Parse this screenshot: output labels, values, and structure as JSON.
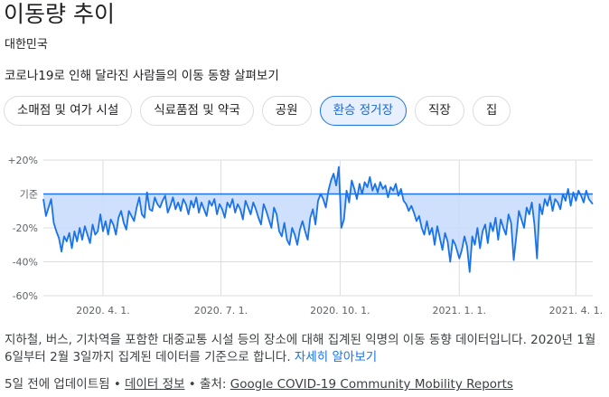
{
  "header": {
    "title": "이동량 추이",
    "region": "대한민국",
    "subtitle": "코로나19로 인해 달라진 사람들의 이동 동향 살펴보기"
  },
  "chips": [
    {
      "label": "소매점 및 여가 시설",
      "selected": false
    },
    {
      "label": "식료품점 및 약국",
      "selected": false
    },
    {
      "label": "공원",
      "selected": false
    },
    {
      "label": "환승 정거장",
      "selected": true
    },
    {
      "label": "직장",
      "selected": false
    },
    {
      "label": "집",
      "selected": false
    }
  ],
  "colors": {
    "line": "#1a73e8",
    "fill": "#c6dafc",
    "grid": "#dadce0",
    "chip_selected_bg": "#e8f0fe",
    "chip_selected_border": "#1a73e8"
  },
  "chart_data": {
    "type": "area",
    "title": "",
    "xlabel": "",
    "ylabel": "",
    "ylim": [
      -60,
      20
    ],
    "y_ticks": [
      {
        "value": 20,
        "label": "+20%"
      },
      {
        "value": 0,
        "label": "기준"
      },
      {
        "value": -20,
        "label": "-20%"
      },
      {
        "value": -40,
        "label": "-40%"
      },
      {
        "value": -60,
        "label": "-60%"
      }
    ],
    "x_ticks": [
      "2020. 4. 1.",
      "2020. 7. 1.",
      "2020. 10. 1.",
      "2021. 1. 1.",
      "2021. 4. 1."
    ],
    "x_range": [
      "2020-02-15",
      "2021-04-14"
    ],
    "grid": true,
    "series": [
      {
        "values": [
          {
            "x": "2020-02-15",
            "y": -3
          },
          {
            "x": "2020-02-17",
            "y": -13
          },
          {
            "x": "2020-02-19",
            "y": -8
          },
          {
            "x": "2020-02-21",
            "y": -3
          },
          {
            "x": "2020-02-23",
            "y": -17
          },
          {
            "x": "2020-02-25",
            "y": -22
          },
          {
            "x": "2020-02-27",
            "y": -26
          },
          {
            "x": "2020-02-29",
            "y": -34
          },
          {
            "x": "2020-03-02",
            "y": -25
          },
          {
            "x": "2020-03-04",
            "y": -28
          },
          {
            "x": "2020-03-06",
            "y": -23
          },
          {
            "x": "2020-03-08",
            "y": -32
          },
          {
            "x": "2020-03-10",
            "y": -22
          },
          {
            "x": "2020-03-12",
            "y": -28
          },
          {
            "x": "2020-03-14",
            "y": -20
          },
          {
            "x": "2020-03-16",
            "y": -27
          },
          {
            "x": "2020-03-18",
            "y": -19
          },
          {
            "x": "2020-03-20",
            "y": -24
          },
          {
            "x": "2020-03-22",
            "y": -29
          },
          {
            "x": "2020-03-24",
            "y": -18
          },
          {
            "x": "2020-03-26",
            "y": -24
          },
          {
            "x": "2020-03-28",
            "y": -22
          },
          {
            "x": "2020-03-30",
            "y": -12
          },
          {
            "x": "2020-04-01",
            "y": -22
          },
          {
            "x": "2020-04-03",
            "y": -16
          },
          {
            "x": "2020-04-05",
            "y": -24
          },
          {
            "x": "2020-04-07",
            "y": -15
          },
          {
            "x": "2020-04-09",
            "y": -18
          },
          {
            "x": "2020-04-11",
            "y": -24
          },
          {
            "x": "2020-04-13",
            "y": -14
          },
          {
            "x": "2020-04-15",
            "y": -10
          },
          {
            "x": "2020-04-17",
            "y": -17
          },
          {
            "x": "2020-04-19",
            "y": -21
          },
          {
            "x": "2020-04-21",
            "y": -10
          },
          {
            "x": "2020-04-23",
            "y": -13
          },
          {
            "x": "2020-04-25",
            "y": -16
          },
          {
            "x": "2020-04-27",
            "y": -8
          },
          {
            "x": "2020-04-29",
            "y": -2
          },
          {
            "x": "2020-05-01",
            "y": -12
          },
          {
            "x": "2020-05-03",
            "y": -14
          },
          {
            "x": "2020-05-05",
            "y": 1
          },
          {
            "x": "2020-05-07",
            "y": -9
          },
          {
            "x": "2020-05-09",
            "y": -10
          },
          {
            "x": "2020-05-11",
            "y": -2
          },
          {
            "x": "2020-05-13",
            "y": -6
          },
          {
            "x": "2020-05-15",
            "y": -8
          },
          {
            "x": "2020-05-17",
            "y": -4
          },
          {
            "x": "2020-05-19",
            "y": -1
          },
          {
            "x": "2020-05-21",
            "y": -11
          },
          {
            "x": "2020-05-23",
            "y": -7
          },
          {
            "x": "2020-05-25",
            "y": -2
          },
          {
            "x": "2020-05-27",
            "y": -9
          },
          {
            "x": "2020-05-29",
            "y": -5
          },
          {
            "x": "2020-05-31",
            "y": -10
          },
          {
            "x": "2020-06-02",
            "y": -3
          },
          {
            "x": "2020-06-04",
            "y": -6
          },
          {
            "x": "2020-06-06",
            "y": -12
          },
          {
            "x": "2020-06-08",
            "y": -4
          },
          {
            "x": "2020-06-10",
            "y": -8
          },
          {
            "x": "2020-06-12",
            "y": -2
          },
          {
            "x": "2020-06-14",
            "y": -11
          },
          {
            "x": "2020-06-16",
            "y": -5
          },
          {
            "x": "2020-06-18",
            "y": -9
          },
          {
            "x": "2020-06-20",
            "y": -13
          },
          {
            "x": "2020-06-22",
            "y": -4
          },
          {
            "x": "2020-06-24",
            "y": -7
          },
          {
            "x": "2020-06-26",
            "y": -3
          },
          {
            "x": "2020-06-28",
            "y": -12
          },
          {
            "x": "2020-06-30",
            "y": -6
          },
          {
            "x": "2020-07-02",
            "y": -9
          },
          {
            "x": "2020-07-04",
            "y": -14
          },
          {
            "x": "2020-07-06",
            "y": -5
          },
          {
            "x": "2020-07-08",
            "y": -8
          },
          {
            "x": "2020-07-10",
            "y": -3
          },
          {
            "x": "2020-07-12",
            "y": -11
          },
          {
            "x": "2020-07-14",
            "y": -6
          },
          {
            "x": "2020-07-16",
            "y": -9
          },
          {
            "x": "2020-07-18",
            "y": -15
          },
          {
            "x": "2020-07-20",
            "y": -4
          },
          {
            "x": "2020-07-22",
            "y": -8
          },
          {
            "x": "2020-07-24",
            "y": -12
          },
          {
            "x": "2020-07-26",
            "y": -5
          },
          {
            "x": "2020-07-28",
            "y": -9
          },
          {
            "x": "2020-07-30",
            "y": -14
          },
          {
            "x": "2020-08-01",
            "y": -18
          },
          {
            "x": "2020-08-03",
            "y": -6
          },
          {
            "x": "2020-08-05",
            "y": -10
          },
          {
            "x": "2020-08-07",
            "y": -15
          },
          {
            "x": "2020-08-09",
            "y": -20
          },
          {
            "x": "2020-08-11",
            "y": -8
          },
          {
            "x": "2020-08-13",
            "y": -12
          },
          {
            "x": "2020-08-15",
            "y": -22
          },
          {
            "x": "2020-08-17",
            "y": -25
          },
          {
            "x": "2020-08-19",
            "y": -17
          },
          {
            "x": "2020-08-21",
            "y": -27
          },
          {
            "x": "2020-08-23",
            "y": -30
          },
          {
            "x": "2020-08-25",
            "y": -20
          },
          {
            "x": "2020-08-27",
            "y": -24
          },
          {
            "x": "2020-08-29",
            "y": -30
          },
          {
            "x": "2020-08-31",
            "y": -21
          },
          {
            "x": "2020-09-02",
            "y": -16
          },
          {
            "x": "2020-09-04",
            "y": -22
          },
          {
            "x": "2020-09-06",
            "y": -27
          },
          {
            "x": "2020-09-08",
            "y": -14
          },
          {
            "x": "2020-09-10",
            "y": -9
          },
          {
            "x": "2020-09-12",
            "y": -18
          },
          {
            "x": "2020-09-14",
            "y": -4
          },
          {
            "x": "2020-09-16",
            "y": 0
          },
          {
            "x": "2020-09-18",
            "y": -3
          },
          {
            "x": "2020-09-20",
            "y": -8
          },
          {
            "x": "2020-09-22",
            "y": 2
          },
          {
            "x": "2020-09-24",
            "y": 8
          },
          {
            "x": "2020-09-26",
            "y": 12
          },
          {
            "x": "2020-09-28",
            "y": 5
          },
          {
            "x": "2020-09-30",
            "y": 16
          },
          {
            "x": "2020-10-02",
            "y": -20
          },
          {
            "x": "2020-10-04",
            "y": -15
          },
          {
            "x": "2020-10-06",
            "y": 2
          },
          {
            "x": "2020-10-08",
            "y": -5
          },
          {
            "x": "2020-10-10",
            "y": 8
          },
          {
            "x": "2020-10-12",
            "y": 3
          },
          {
            "x": "2020-10-14",
            "y": -3
          },
          {
            "x": "2020-10-16",
            "y": 6
          },
          {
            "x": "2020-10-18",
            "y": 0
          },
          {
            "x": "2020-10-20",
            "y": 7
          },
          {
            "x": "2020-10-22",
            "y": 4
          },
          {
            "x": "2020-10-24",
            "y": 10
          },
          {
            "x": "2020-10-26",
            "y": 2
          },
          {
            "x": "2020-10-28",
            "y": 6
          },
          {
            "x": "2020-10-30",
            "y": 1
          },
          {
            "x": "2020-11-01",
            "y": 7
          },
          {
            "x": "2020-11-03",
            "y": 3
          },
          {
            "x": "2020-11-05",
            "y": 5
          },
          {
            "x": "2020-11-07",
            "y": -2
          },
          {
            "x": "2020-11-09",
            "y": 4
          },
          {
            "x": "2020-11-11",
            "y": 2
          },
          {
            "x": "2020-11-13",
            "y": 6
          },
          {
            "x": "2020-11-15",
            "y": -1
          },
          {
            "x": "2020-11-17",
            "y": 3
          },
          {
            "x": "2020-11-19",
            "y": -4
          },
          {
            "x": "2020-11-21",
            "y": -6
          },
          {
            "x": "2020-11-23",
            "y": -10
          },
          {
            "x": "2020-11-25",
            "y": -7
          },
          {
            "x": "2020-11-27",
            "y": -11
          },
          {
            "x": "2020-11-29",
            "y": -16
          },
          {
            "x": "2020-12-01",
            "y": -13
          },
          {
            "x": "2020-12-03",
            "y": -20
          },
          {
            "x": "2020-12-05",
            "y": -24
          },
          {
            "x": "2020-12-07",
            "y": -16
          },
          {
            "x": "2020-12-09",
            "y": -24
          },
          {
            "x": "2020-12-11",
            "y": -20
          },
          {
            "x": "2020-12-13",
            "y": -30
          },
          {
            "x": "2020-12-15",
            "y": -19
          },
          {
            "x": "2020-12-17",
            "y": -26
          },
          {
            "x": "2020-12-19",
            "y": -33
          },
          {
            "x": "2020-12-21",
            "y": -23
          },
          {
            "x": "2020-12-23",
            "y": -28
          },
          {
            "x": "2020-12-25",
            "y": -40
          },
          {
            "x": "2020-12-27",
            "y": -27
          },
          {
            "x": "2020-12-29",
            "y": -30
          },
          {
            "x": "2021-01-01",
            "y": -38
          },
          {
            "x": "2021-01-03",
            "y": -33
          },
          {
            "x": "2021-01-05",
            "y": -25
          },
          {
            "x": "2021-01-07",
            "y": -31
          },
          {
            "x": "2021-01-09",
            "y": -46
          },
          {
            "x": "2021-01-11",
            "y": -25
          },
          {
            "x": "2021-01-13",
            "y": -30
          },
          {
            "x": "2021-01-15",
            "y": -20
          },
          {
            "x": "2021-01-17",
            "y": -32
          },
          {
            "x": "2021-01-19",
            "y": -22
          },
          {
            "x": "2021-01-21",
            "y": -18
          },
          {
            "x": "2021-01-23",
            "y": -29
          },
          {
            "x": "2021-01-25",
            "y": -17
          },
          {
            "x": "2021-01-27",
            "y": -22
          },
          {
            "x": "2021-01-29",
            "y": -14
          },
          {
            "x": "2021-01-31",
            "y": -27
          },
          {
            "x": "2021-02-02",
            "y": -15
          },
          {
            "x": "2021-02-04",
            "y": -20
          },
          {
            "x": "2021-02-06",
            "y": -24
          },
          {
            "x": "2021-02-08",
            "y": -12
          },
          {
            "x": "2021-02-10",
            "y": -17
          },
          {
            "x": "2021-02-12",
            "y": -39
          },
          {
            "x": "2021-02-14",
            "y": -25
          },
          {
            "x": "2021-02-16",
            "y": -10
          },
          {
            "x": "2021-02-18",
            "y": -15
          },
          {
            "x": "2021-02-20",
            "y": -20
          },
          {
            "x": "2021-02-22",
            "y": -8
          },
          {
            "x": "2021-02-24",
            "y": -12
          },
          {
            "x": "2021-02-26",
            "y": -5
          },
          {
            "x": "2021-02-28",
            "y": -18
          },
          {
            "x": "2021-03-02",
            "y": -38
          },
          {
            "x": "2021-03-04",
            "y": -6
          },
          {
            "x": "2021-03-06",
            "y": -12
          },
          {
            "x": "2021-03-08",
            "y": -3
          },
          {
            "x": "2021-03-10",
            "y": -7
          },
          {
            "x": "2021-03-12",
            "y": -1
          },
          {
            "x": "2021-03-14",
            "y": -10
          },
          {
            "x": "2021-03-16",
            "y": -3
          },
          {
            "x": "2021-03-18",
            "y": -5
          },
          {
            "x": "2021-03-20",
            "y": -9
          },
          {
            "x": "2021-03-22",
            "y": 0
          },
          {
            "x": "2021-03-24",
            "y": -4
          },
          {
            "x": "2021-03-26",
            "y": 3
          },
          {
            "x": "2021-03-28",
            "y": -7
          },
          {
            "x": "2021-03-30",
            "y": 1
          },
          {
            "x": "2021-04-01",
            "y": -4
          },
          {
            "x": "2021-04-03",
            "y": 2
          },
          {
            "x": "2021-04-05",
            "y": -1
          },
          {
            "x": "2021-04-07",
            "y": -5
          },
          {
            "x": "2021-04-09",
            "y": 2
          },
          {
            "x": "2021-04-11",
            "y": -3
          },
          {
            "x": "2021-04-14",
            "y": -6
          }
        ]
      }
    ]
  },
  "description": {
    "text": "지하철, 버스, 기차역을 포함한 대중교통 시설 등의 장소에 대해 집계된 익명의 이동 동향 데이터입니다. 2020년 1월 6일부터 2월 3일까지 집계된 데이터를 기준으로 합니다. ",
    "link": "자세히 알아보기"
  },
  "footer": {
    "updated": "5일 전에 업데이트됨",
    "sep1": " • ",
    "data_info_link": "데이터 정보",
    "sep2": " • ",
    "source_prefix": "출처: ",
    "source_link": "Google COVID-19 Community Mobility Reports"
  }
}
